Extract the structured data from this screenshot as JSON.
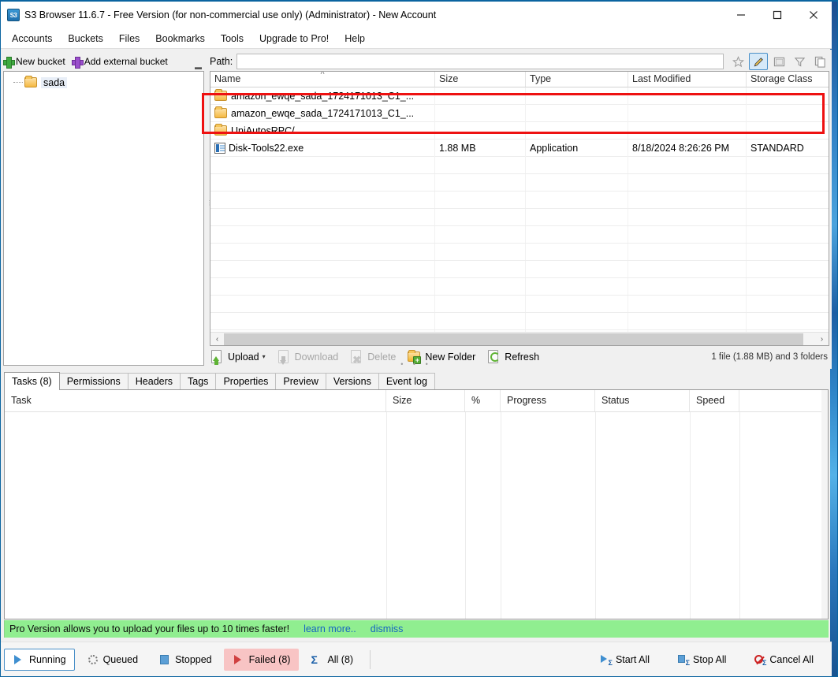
{
  "window": {
    "title": "S3 Browser 11.6.7 - Free Version (for non-commercial use only) (Administrator) - New Account",
    "app_icon_text": "S3",
    "minimize": "—",
    "maximize": "☐",
    "close": "✕"
  },
  "menu": [
    {
      "label": "Accounts"
    },
    {
      "label": "Buckets"
    },
    {
      "label": "Files"
    },
    {
      "label": "Bookmarks"
    },
    {
      "label": "Tools"
    },
    {
      "label": "Upgrade to Pro!"
    },
    {
      "label": "Help"
    }
  ],
  "sidebar": {
    "new_bucket": "New bucket",
    "add_external_bucket": "Add external bucket",
    "overflow": "▬",
    "buckets": [
      {
        "label": "sada"
      }
    ]
  },
  "path_bar": {
    "label": "Path:",
    "value": "",
    "placeholder": "",
    "icons": [
      {
        "name": "favorite-star-icon",
        "glyph": "☆",
        "active": false
      },
      {
        "name": "edit-pencil-icon",
        "glyph": "✎",
        "active": true
      },
      {
        "name": "panel-toggle-icon",
        "glyph": "▣",
        "active": false
      },
      {
        "name": "filter-funnel-icon",
        "glyph": "▽",
        "active": false
      },
      {
        "name": "copy-icon",
        "glyph": "❐",
        "active": false
      }
    ]
  },
  "file_list": {
    "columns": [
      "Name",
      "Size",
      "Type",
      "Last Modified",
      "Storage Class"
    ],
    "sort_caret": "˄",
    "rows": [
      {
        "name": "amazon_ewqe_sada_1724171013_C1_...",
        "size": "",
        "type": "",
        "modified": "",
        "storage": "",
        "icon": "folder-icon"
      },
      {
        "name": "amazon_ewqe_sada_1724171013_C1_...",
        "size": "",
        "type": "",
        "modified": "",
        "storage": "",
        "icon": "folder-icon"
      },
      {
        "name": "UniAutosRPC/",
        "size": "",
        "type": "",
        "modified": "",
        "storage": "",
        "icon": "folder-icon"
      },
      {
        "name": "Disk-Tools22.exe",
        "size": "1.88 MB",
        "type": "Application",
        "modified": "8/18/2024 8:26:26 PM",
        "storage": "STANDARD",
        "icon": "executable-icon"
      }
    ],
    "scroll_left_arrow": "‹",
    "scroll_right_arrow": "›",
    "status": "1 file (1.88 MB) and 3 folders"
  },
  "file_actions": [
    {
      "label": "Upload",
      "name": "upload-button",
      "disabled": false,
      "has_caret": true
    },
    {
      "label": "Download",
      "name": "download-button",
      "disabled": true,
      "has_caret": false
    },
    {
      "label": "Delete",
      "name": "delete-button",
      "disabled": true,
      "has_caret": false
    },
    {
      "label": "New Folder",
      "name": "new-folder-button",
      "disabled": false,
      "has_caret": false
    },
    {
      "label": "Refresh",
      "name": "refresh-button",
      "disabled": false,
      "has_caret": false
    }
  ],
  "upload_caret": "▾",
  "tabs": [
    {
      "label": "Tasks (8)",
      "active": true
    },
    {
      "label": "Permissions",
      "active": false
    },
    {
      "label": "Headers",
      "active": false
    },
    {
      "label": "Tags",
      "active": false
    },
    {
      "label": "Properties",
      "active": false
    },
    {
      "label": "Preview",
      "active": false
    },
    {
      "label": "Versions",
      "active": false
    },
    {
      "label": "Event log",
      "active": false
    }
  ],
  "task_grid": {
    "columns": [
      "Task",
      "Size",
      "%",
      "Progress",
      "Status",
      "Speed"
    ],
    "rows": []
  },
  "promo": {
    "text": "Pro Version allows you to upload your files up to 10 times faster!",
    "learn_more": "learn more..",
    "dismiss": "dismiss",
    "background": "#90ee90",
    "link_color": "#1565c0"
  },
  "status_bar": {
    "filters": [
      {
        "label": "Running",
        "name": "filter-running",
        "state": "selected"
      },
      {
        "label": "Queued",
        "name": "filter-queued",
        "state": "normal"
      },
      {
        "label": "Stopped",
        "name": "filter-stopped",
        "state": "normal"
      },
      {
        "label": "Failed (8)",
        "name": "filter-failed",
        "state": "failed"
      },
      {
        "label": "All (8)",
        "name": "filter-all",
        "state": "normal"
      }
    ],
    "actions": [
      {
        "label": "Start All",
        "name": "start-all-button"
      },
      {
        "label": "Stop All",
        "name": "stop-all-button"
      },
      {
        "label": "Cancel All",
        "name": "cancel-all-button"
      }
    ],
    "sigma": "Σ"
  },
  "annotation": {
    "color": "#ee1111"
  }
}
